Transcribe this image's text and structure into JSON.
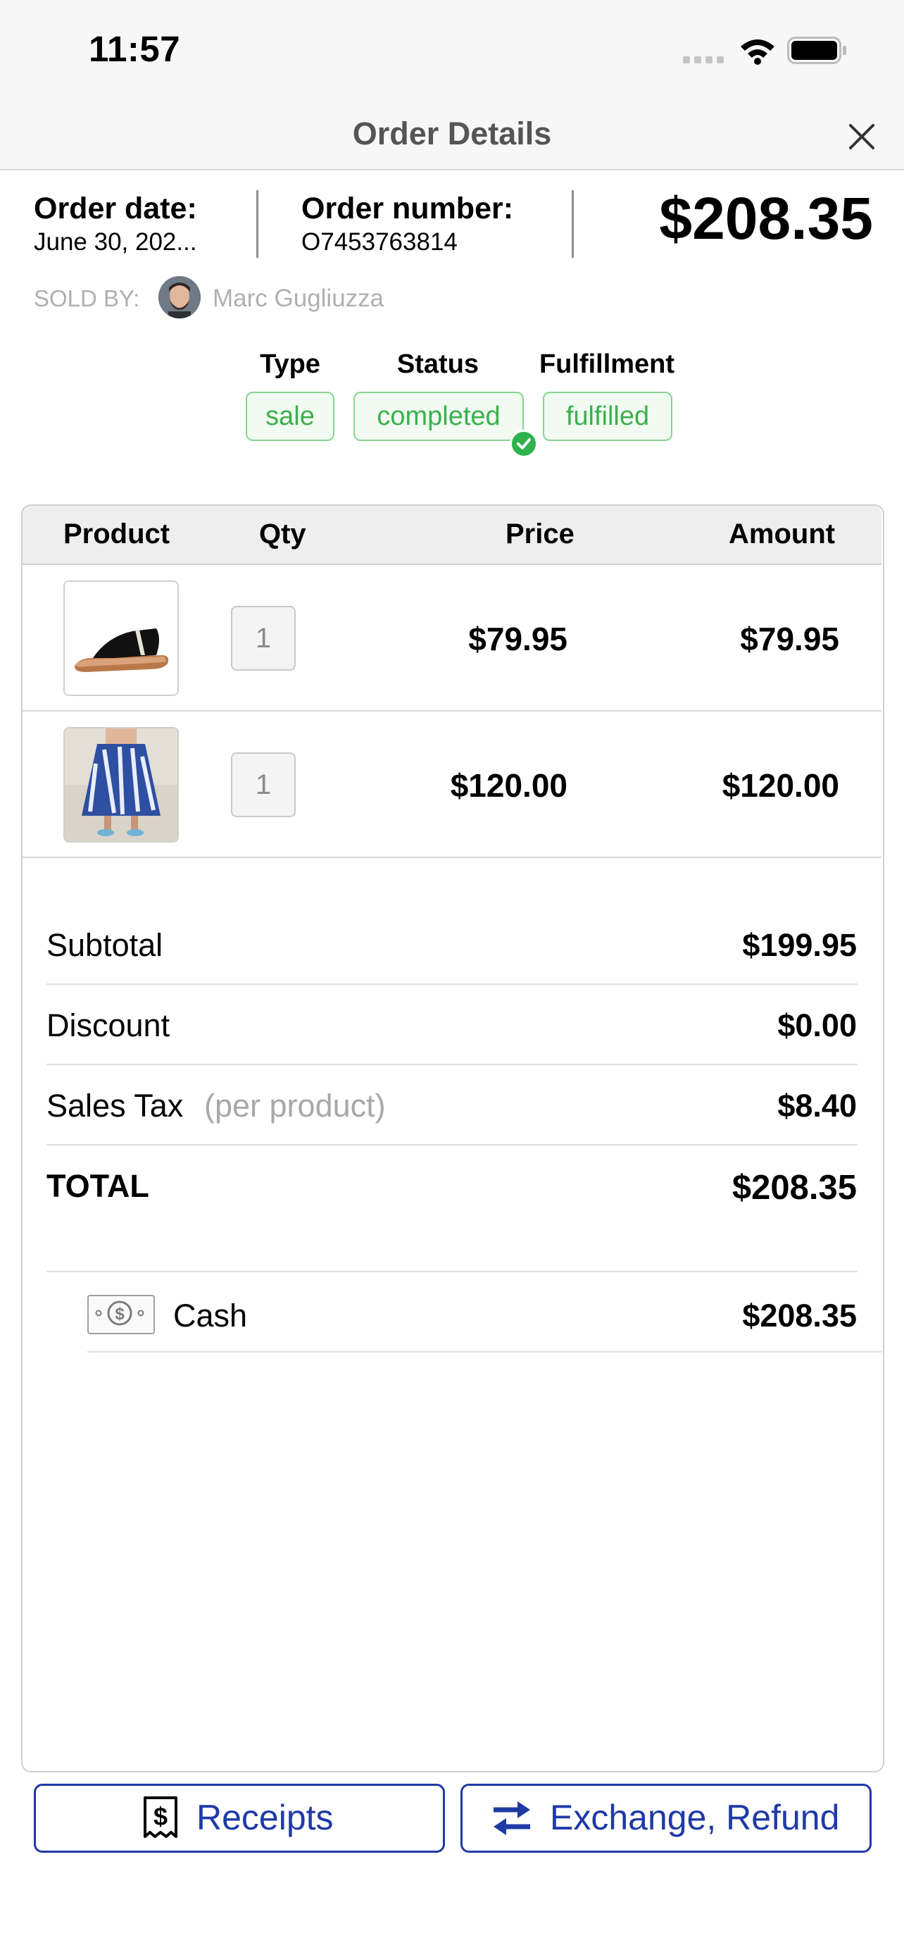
{
  "status_bar": {
    "time": "11:57"
  },
  "header": {
    "title": "Order Details"
  },
  "order": {
    "date_label": "Order date:",
    "date_value": "June 30, 202...",
    "number_label": "Order number:",
    "number_value": "O7453763814",
    "total": "$208.35",
    "sold_by_label": "SOLD BY:",
    "seller_name": "Marc Gugliuzza"
  },
  "meta": {
    "type_label": "Type",
    "type_value": "sale",
    "status_label": "Status",
    "status_value": "completed",
    "fulfillment_label": "Fulfillment",
    "fulfillment_value": "fulfilled"
  },
  "table": {
    "columns": [
      "Product",
      "Qty",
      "Price",
      "Amount"
    ],
    "rows": [
      {
        "product_image": "black-sandal",
        "qty": "1",
        "price": "$79.95",
        "amount": "$79.95"
      },
      {
        "product_image": "blue-patterned-skirt",
        "qty": "1",
        "price": "$120.00",
        "amount": "$120.00"
      }
    ]
  },
  "summary": {
    "subtotal_label": "Subtotal",
    "subtotal": "$199.95",
    "discount_label": "Discount",
    "discount": "$0.00",
    "tax_label": "Sales Tax",
    "tax_note": "(per product)",
    "tax": "$8.40",
    "total_label": "TOTAL",
    "total": "$208.35"
  },
  "payment": {
    "method": "Cash",
    "amount": "$208.35",
    "icon": "cash-icon"
  },
  "actions": {
    "receipts_label": "Receipts",
    "exchange_label": "Exchange, Refund"
  },
  "colors": {
    "accent": "#1f3aa6",
    "badge_green": "#3cb04d"
  }
}
